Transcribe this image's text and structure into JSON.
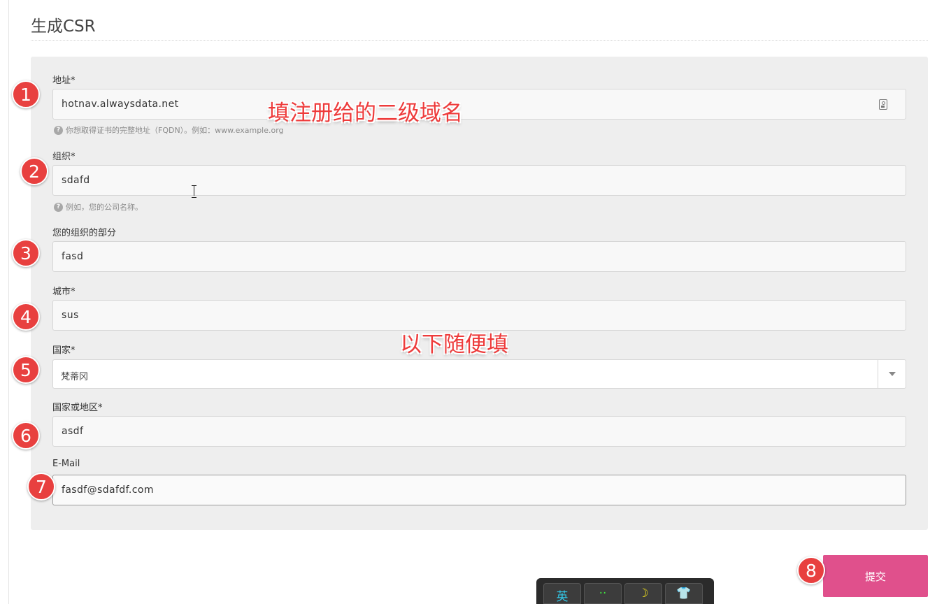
{
  "page": {
    "title": "生成CSR"
  },
  "form": {
    "address": {
      "label": "地址*",
      "value": "hotnav.alwaysdata.net",
      "help": "你想取得证书的完整地址（FQDN）。例如：www.example.org"
    },
    "organization": {
      "label": "组织*",
      "value": "sdafd",
      "help": "例如，您的公司名称。"
    },
    "org_unit": {
      "label": "您的组织的部分",
      "value": "fasd"
    },
    "city": {
      "label": "城市*",
      "value": "sus"
    },
    "country": {
      "label": "国家*",
      "selected": "梵蒂冈"
    },
    "state": {
      "label": "国家或地区*",
      "value": "asdf"
    },
    "email": {
      "label": "E-Mail",
      "value": "fasdf@sdafdf.com"
    },
    "submit_label": "提交"
  },
  "annotations": {
    "steps": [
      "1",
      "2",
      "3",
      "4",
      "5",
      "6",
      "7",
      "8"
    ],
    "subdomain_note": "填注册给的二级域名",
    "fill_randomly_note": "以下随便填",
    "badge_color": "#e8403f"
  },
  "ime_toolbar": {
    "keys": [
      "英",
      "··",
      "☽",
      "👕"
    ]
  },
  "colors": {
    "panel_bg": "#eeeeee",
    "submit_bg": "#e0508c",
    "annotation_text": "#ee3b3b"
  }
}
